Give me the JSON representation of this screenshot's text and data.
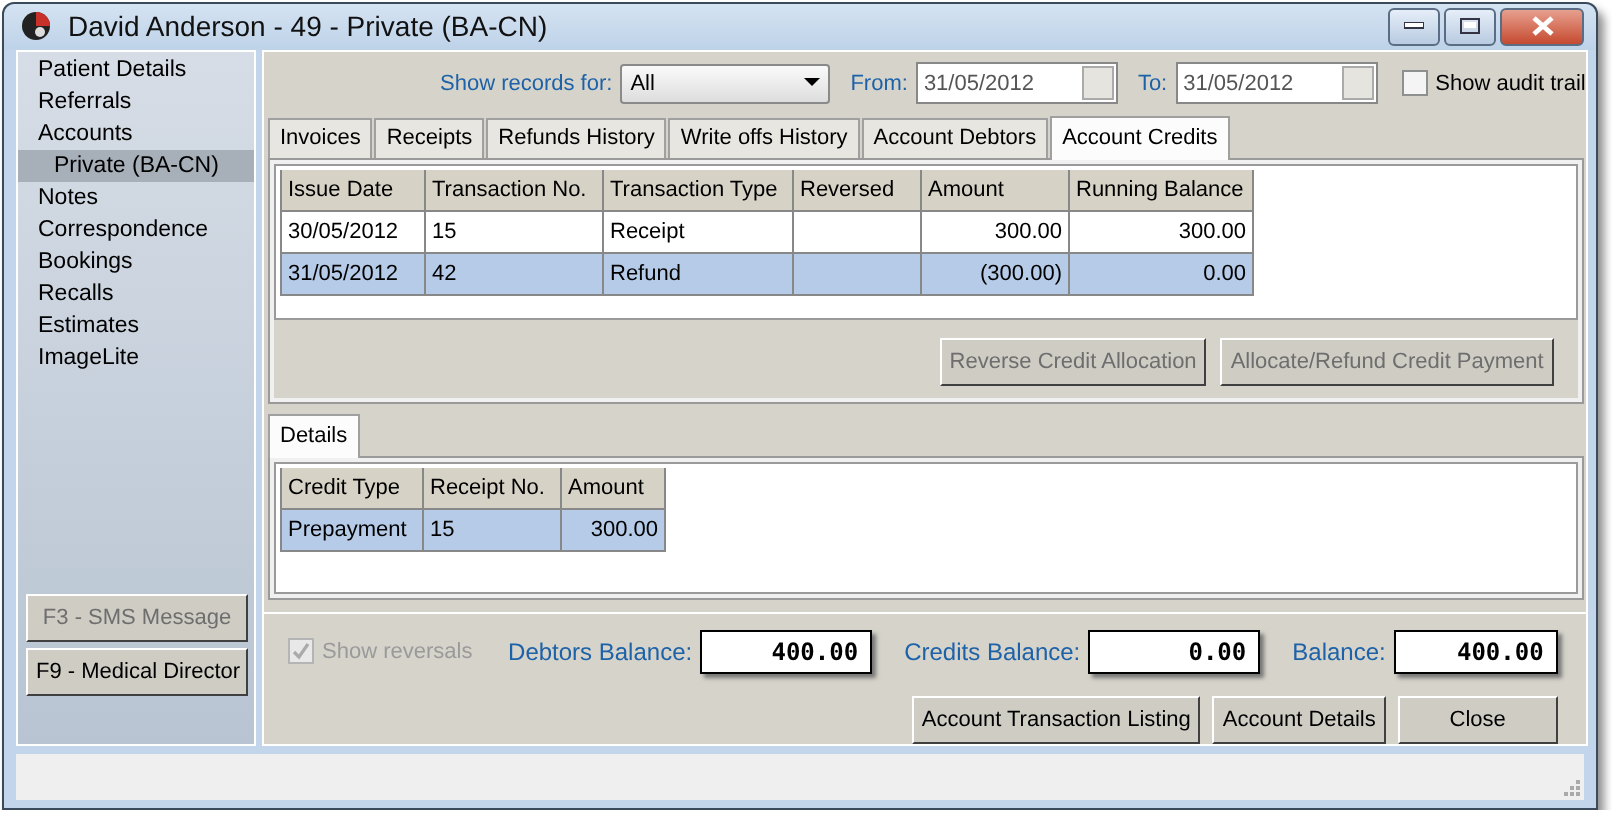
{
  "window": {
    "title": "David Anderson - 49 - Private (BA-CN)"
  },
  "sidebar": {
    "items": [
      {
        "label": "Patient Details",
        "selected": false
      },
      {
        "label": "Referrals",
        "selected": false
      },
      {
        "label": "Accounts",
        "selected": false,
        "children": [
          {
            "label": "Private (BA-CN)",
            "selected": true
          }
        ]
      },
      {
        "label": "Notes",
        "selected": false
      },
      {
        "label": "Correspondence",
        "selected": false
      },
      {
        "label": "Bookings",
        "selected": false
      },
      {
        "label": "Recalls",
        "selected": false
      },
      {
        "label": "Estimates",
        "selected": false
      },
      {
        "label": "ImageLite",
        "selected": false
      }
    ],
    "buttons": [
      {
        "label": "F3 - SMS Message",
        "disabled": true
      },
      {
        "label": "F9 - Medical Director",
        "disabled": false
      }
    ]
  },
  "filter": {
    "show_records_label": "Show records for:",
    "show_records_value": "All",
    "from_label": "From:",
    "from_value": "31/05/2012",
    "to_label": "To:",
    "to_value": "31/05/2012",
    "audit_trail": {
      "label": "Show audit trail",
      "checked": false
    }
  },
  "tabs": [
    {
      "label": "Invoices",
      "selected": false
    },
    {
      "label": "Receipts",
      "selected": false
    },
    {
      "label": "Refunds History",
      "selected": false
    },
    {
      "label": "Write offs History",
      "selected": false
    },
    {
      "label": "Account Debtors",
      "selected": false
    },
    {
      "label": "Account Credits",
      "selected": true
    }
  ],
  "credits_table": {
    "columns": [
      {
        "label": "Issue Date"
      },
      {
        "label": "Transaction No."
      },
      {
        "label": "Transaction Type"
      },
      {
        "label": "Reversed"
      },
      {
        "label": "Amount",
        "numeric": true
      },
      {
        "label": "Running Balance",
        "numeric": true
      }
    ],
    "rows": [
      {
        "cells": [
          "30/05/2012",
          "15",
          "Receipt",
          "",
          "300.00",
          "300.00"
        ],
        "selected": false
      },
      {
        "cells": [
          "31/05/2012",
          "42",
          "Refund",
          "",
          "(300.00)",
          "0.00"
        ],
        "selected": true
      }
    ]
  },
  "action_buttons": [
    {
      "label": "Reverse Credit Allocation",
      "disabled": true
    },
    {
      "label": "Allocate/Refund Credit Payment",
      "disabled": true
    }
  ],
  "details": {
    "tab": {
      "label": "Details",
      "selected": true
    },
    "table": {
      "columns": [
        {
          "label": "Credit Type"
        },
        {
          "label": "Receipt No."
        },
        {
          "label": "Amount",
          "numeric": true
        }
      ],
      "rows": [
        {
          "cells": [
            "Prepayment",
            "15",
            "300.00"
          ],
          "selected": true
        }
      ]
    }
  },
  "show_reversals": {
    "label": "Show reversals",
    "checked": true,
    "disabled": true
  },
  "balances": [
    {
      "label": "Debtors Balance:",
      "value": "400.00"
    },
    {
      "label": "Credits Balance:",
      "value": "0.00"
    },
    {
      "label": "Balance:",
      "value": "400.00"
    }
  ],
  "footer_buttons": [
    "Account Transaction Listing",
    "Account Details",
    "Close"
  ]
}
